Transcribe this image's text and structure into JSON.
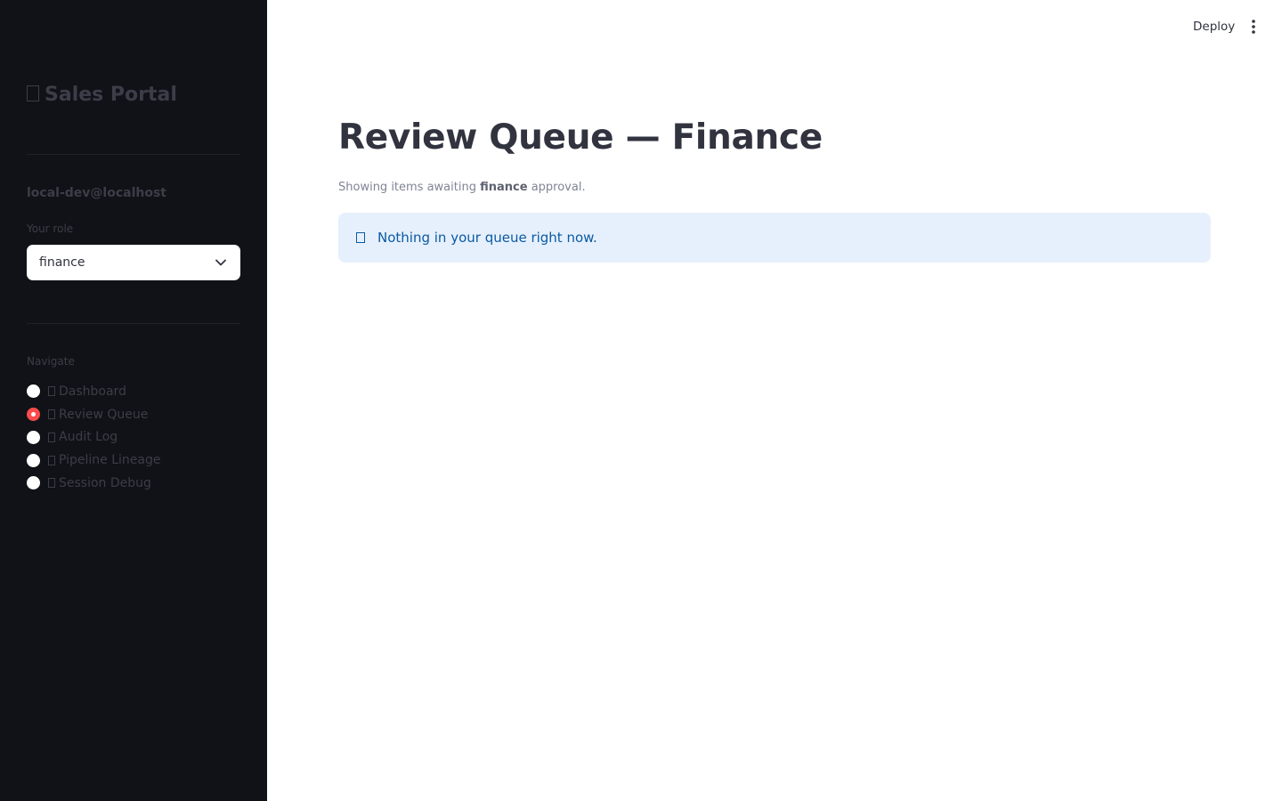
{
  "sidebar": {
    "brand": "Sales Portal",
    "brand_icon": "portal-icon",
    "user": "local-dev@localhost",
    "role_label": "Your role",
    "role_value": "finance",
    "nav_label": "Navigate",
    "nav": [
      {
        "label": "Dashboard",
        "active": false
      },
      {
        "label": "Review Queue",
        "active": true
      },
      {
        "label": "Audit Log",
        "active": false
      },
      {
        "label": "Pipeline Lineage",
        "active": false
      },
      {
        "label": "Session Debug",
        "active": false
      }
    ]
  },
  "toolbar": {
    "deploy_label": "Deploy",
    "menu_icon": "kebab-menu-icon"
  },
  "main": {
    "title": "Review Queue — Finance",
    "subtitle_prefix": "Showing items awaiting ",
    "subtitle_role": "finance",
    "subtitle_suffix": " approval.",
    "info_message": "Nothing in your queue right now.",
    "info_icon": "info-icon"
  },
  "colors": {
    "sidebar_bg": "#111217",
    "accent": "#ff4b4b",
    "info_bg": "#e6f0fc",
    "info_text": "#0b5aa3"
  }
}
